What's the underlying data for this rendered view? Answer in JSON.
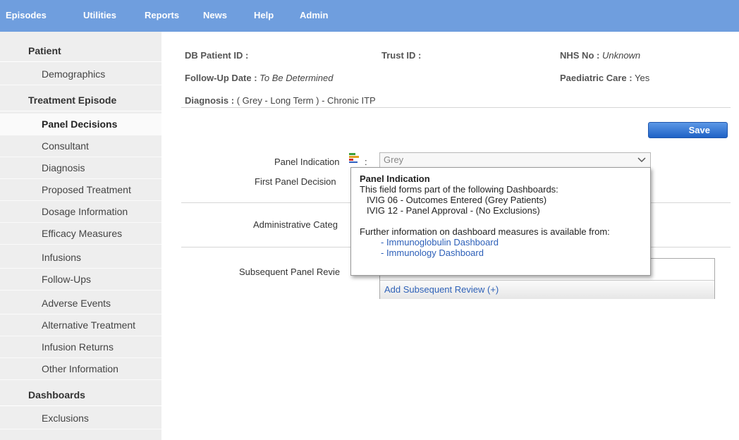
{
  "nav": {
    "items": [
      "Episodes",
      "Utilities",
      "Reports",
      "News",
      "Help",
      "Admin"
    ],
    "bg_color": "#6f9ede"
  },
  "sidebar": {
    "patient_header": "Patient",
    "demographics": "Demographics",
    "treatment_header": "Treatment Episode",
    "items": [
      "Panel Decisions",
      "Consultant",
      "Diagnosis",
      "Proposed Treatment",
      "Dosage Information",
      "Efficacy Measures",
      "Infusions",
      "Follow-Ups",
      "Adverse Events",
      "Alternative Treatment",
      "Infusion Returns",
      "Other Information"
    ],
    "active_item": "Panel Decisions",
    "dashboards_header": "Dashboards",
    "exclusions": "Exclusions"
  },
  "header": {
    "db_patient_id_label": "DB Patient ID :",
    "trust_id_label": "Trust ID :",
    "nhs_no_label": "NHS No :",
    "nhs_no_value": "Unknown",
    "follow_up_label": "Follow-Up Date :",
    "follow_up_value": "To Be Determined",
    "paediatric_label": "Paediatric Care :",
    "paediatric_value": "Yes",
    "diagnosis_label": "Diagnosis :",
    "diagnosis_value": "( Grey - Long Term ) - Chronic ITP"
  },
  "form": {
    "save_label": "Save",
    "panel_indication_label": "Panel Indication",
    "panel_indication_value": "Grey",
    "first_panel_decision_label": "First Panel Decision",
    "administrative_category_label": "Administrative Categ",
    "subsequent_panel_review_label": "Subsequent Panel Revie",
    "add_subsequent_review": "Add Subsequent Review (+)"
  },
  "tooltip": {
    "title": "Panel Indication",
    "intro": "This field forms part of the following Dashboards:",
    "dashboards": [
      "IVIG 06 - Outcomes Entered (Grey Patients)",
      "IVIG 12 - Panel Approval - (No Exclusions)"
    ],
    "further": "Further information on dashboard measures is available from:",
    "links": [
      "- Immunoglobulin Dashboard",
      "- Immunology Dashboard"
    ]
  }
}
